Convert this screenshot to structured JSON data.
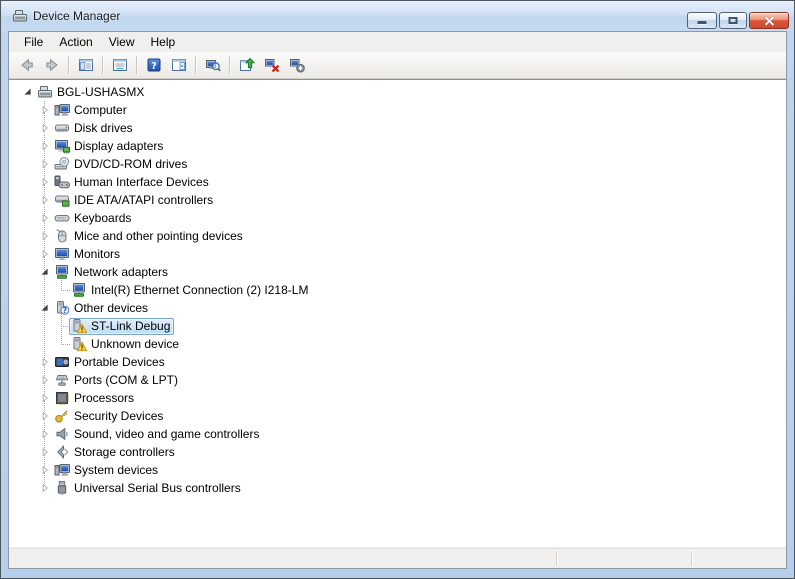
{
  "window": {
    "title": "Device Manager",
    "controls": [
      {
        "name": "minimize"
      },
      {
        "name": "maximize"
      },
      {
        "name": "close"
      }
    ]
  },
  "menubar": {
    "items": [
      "File",
      "Action",
      "View",
      "Help"
    ]
  },
  "toolbar": {
    "items": [
      {
        "type": "button",
        "name": "back",
        "icon": "tb-back"
      },
      {
        "type": "button",
        "name": "forward",
        "icon": "tb-forward"
      },
      {
        "type": "separator"
      },
      {
        "type": "button",
        "name": "show-hide-console-tree",
        "icon": "tb-console-tree"
      },
      {
        "type": "separator"
      },
      {
        "type": "button",
        "name": "properties",
        "icon": "tb-properties"
      },
      {
        "type": "separator"
      },
      {
        "type": "button",
        "name": "help",
        "icon": "tb-help"
      },
      {
        "type": "button",
        "name": "show-hide-action-pane",
        "icon": "tb-action-pane"
      },
      {
        "type": "separator"
      },
      {
        "type": "button",
        "name": "scan-for-hardware-changes",
        "icon": "tb-scan"
      },
      {
        "type": "separator"
      },
      {
        "type": "button",
        "name": "update-driver-software",
        "icon": "tb-update"
      },
      {
        "type": "button",
        "name": "uninstall",
        "icon": "tb-uninstall"
      },
      {
        "type": "button",
        "name": "disable",
        "icon": "tb-disable"
      }
    ]
  },
  "tree": {
    "items": [
      {
        "label": "BGL-USHASMX",
        "level": 0,
        "icon": "machine",
        "expander": "expanded",
        "selected": false
      },
      {
        "label": "Computer",
        "level": 1,
        "icon": "computer",
        "expander": "collapsed",
        "selected": false
      },
      {
        "label": "Disk drives",
        "level": 1,
        "icon": "disk",
        "expander": "collapsed",
        "selected": false
      },
      {
        "label": "Display adapters",
        "level": 1,
        "icon": "display",
        "expander": "collapsed",
        "selected": false
      },
      {
        "label": "DVD/CD-ROM drives",
        "level": 1,
        "icon": "dvd",
        "expander": "collapsed",
        "selected": false
      },
      {
        "label": "Human Interface Devices",
        "level": 1,
        "icon": "hid",
        "expander": "collapsed",
        "selected": false
      },
      {
        "label": "IDE ATA/ATAPI controllers",
        "level": 1,
        "icon": "ide",
        "expander": "collapsed",
        "selected": false
      },
      {
        "label": "Keyboards",
        "level": 1,
        "icon": "keyboard",
        "expander": "collapsed",
        "selected": false
      },
      {
        "label": "Mice and other pointing devices",
        "level": 1,
        "icon": "mouse",
        "expander": "collapsed",
        "selected": false
      },
      {
        "label": "Monitors",
        "level": 1,
        "icon": "monitor",
        "expander": "collapsed",
        "selected": false
      },
      {
        "label": "Network adapters",
        "level": 1,
        "icon": "network",
        "expander": "expanded",
        "selected": false
      },
      {
        "label": "Intel(R) Ethernet Connection (2) I218-LM",
        "level": 2,
        "icon": "network",
        "expander": "none",
        "selected": false
      },
      {
        "label": "Other devices",
        "level": 1,
        "icon": "unknown",
        "expander": "expanded",
        "selected": false
      },
      {
        "label": "ST-Link Debug",
        "level": 2,
        "icon": "warning",
        "expander": "none",
        "selected": true
      },
      {
        "label": "Unknown device",
        "level": 2,
        "icon": "warning",
        "expander": "none",
        "selected": false
      },
      {
        "label": "Portable Devices",
        "level": 1,
        "icon": "portable",
        "expander": "collapsed",
        "selected": false
      },
      {
        "label": "Ports (COM & LPT)",
        "level": 1,
        "icon": "ports",
        "expander": "collapsed",
        "selected": false
      },
      {
        "label": "Processors",
        "level": 1,
        "icon": "processor",
        "expander": "collapsed",
        "selected": false
      },
      {
        "label": "Security Devices",
        "level": 1,
        "icon": "security",
        "expander": "collapsed",
        "selected": false
      },
      {
        "label": "Sound, video and game controllers",
        "level": 1,
        "icon": "sound",
        "expander": "collapsed",
        "selected": false
      },
      {
        "label": "Storage controllers",
        "level": 1,
        "icon": "storage",
        "expander": "collapsed",
        "selected": false
      },
      {
        "label": "System devices",
        "level": 1,
        "icon": "computer",
        "expander": "collapsed",
        "selected": false
      },
      {
        "label": "Universal Serial Bus controllers",
        "level": 1,
        "icon": "usb",
        "expander": "collapsed",
        "selected": false
      }
    ]
  },
  "statusbar": {
    "text": ""
  },
  "colors": {
    "selection_border": "#7da2ce",
    "selection_fill": "#cde4f7",
    "warning_yellow": "#ffd54a",
    "titlebar_glass": "#c6dbf2",
    "close_button": "#d9573a"
  }
}
